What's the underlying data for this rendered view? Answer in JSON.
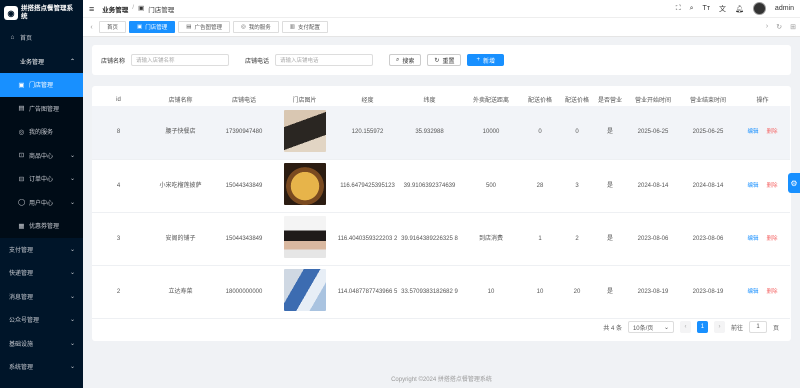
{
  "app": {
    "title": "拼搭搭点餐管理系统"
  },
  "sidebar": {
    "home": "首页",
    "business": "业务管理",
    "items": [
      {
        "label": "门店管理",
        "icon": "store-icon"
      },
      {
        "label": "广告图管理",
        "icon": "image-icon"
      },
      {
        "label": "我的服务",
        "icon": "service-icon"
      },
      {
        "label": "商品中心",
        "icon": "cart-icon"
      },
      {
        "label": "订单中心",
        "icon": "order-icon"
      },
      {
        "label": "用户中心",
        "icon": "user-icon"
      },
      {
        "label": "优惠券管理",
        "icon": "coupon-icon"
      }
    ],
    "groups": [
      "支付管理",
      "快递管理",
      "消息管理",
      "公众号管理",
      "基础设施",
      "系统管理"
    ]
  },
  "header": {
    "breadcrumb_root": "业务管理",
    "breadcrumb_sep": "/",
    "breadcrumb_page": "门店管理",
    "user": "admin"
  },
  "tabs": [
    "首页",
    "门店管理",
    "广告图管理",
    "我的服务",
    "支付配置"
  ],
  "search": {
    "name_label": "店铺名称",
    "name_placeholder": "请输入店铺名称",
    "phone_label": "店铺电话",
    "phone_placeholder": "请输入店铺电话",
    "search_btn": "搜索",
    "reset_btn": "重置",
    "add_btn": "新增"
  },
  "table": {
    "columns": [
      "id",
      "店铺名称",
      "店铺电话",
      "门店图片",
      "经度",
      "纬度",
      "外卖配送距离",
      "配送价格",
      "配送价格",
      "是否营业",
      "营业开始时间",
      "营业结束时间",
      "操作"
    ],
    "rows": [
      {
        "id": "8",
        "name": "腰子快餐店",
        "phone": "17390947480",
        "lng": "120.155972",
        "lat": "35.932988",
        "distance": "10000",
        "price1": "0",
        "price2": "0",
        "open": "是",
        "start": "2025-06-25",
        "end": "2025-06-25"
      },
      {
        "id": "4",
        "name": "小宋吃榴莲披萨",
        "phone": "15044343849",
        "lng": "116.6479425395123",
        "lat": "39.9106392374639",
        "distance": "500",
        "price1": "28",
        "price2": "3",
        "open": "是",
        "start": "2024-08-14",
        "end": "2024-08-14"
      },
      {
        "id": "3",
        "name": "安阁的铺子",
        "phone": "15044343849",
        "lng": "116.4040359322203 2",
        "lat": "39.9164389226325 8",
        "distance": "到店消费",
        "price1": "1",
        "price2": "2",
        "open": "是",
        "start": "2023-08-06",
        "end": "2023-08-06"
      },
      {
        "id": "2",
        "name": "立达寿菜",
        "phone": "18000000000",
        "lng": "114.0487787743966 5",
        "lat": "33.5709383182682 9",
        "distance": "10",
        "price1": "10",
        "price2": "20",
        "open": "是",
        "start": "2023-08-19",
        "end": "2023-08-19"
      }
    ],
    "edit": "编辑",
    "delete": "删除"
  },
  "pager": {
    "total": "共 4 条",
    "size": "10条/页",
    "page": "1",
    "goto": "前往",
    "goto_value": "1",
    "unit": "页"
  },
  "footer": "Copyright ©2024 拼搭搭点餐管理系统",
  "colors": {
    "primary": "#1890ff",
    "sidebar": "#001529",
    "danger": "#f56c6c"
  }
}
